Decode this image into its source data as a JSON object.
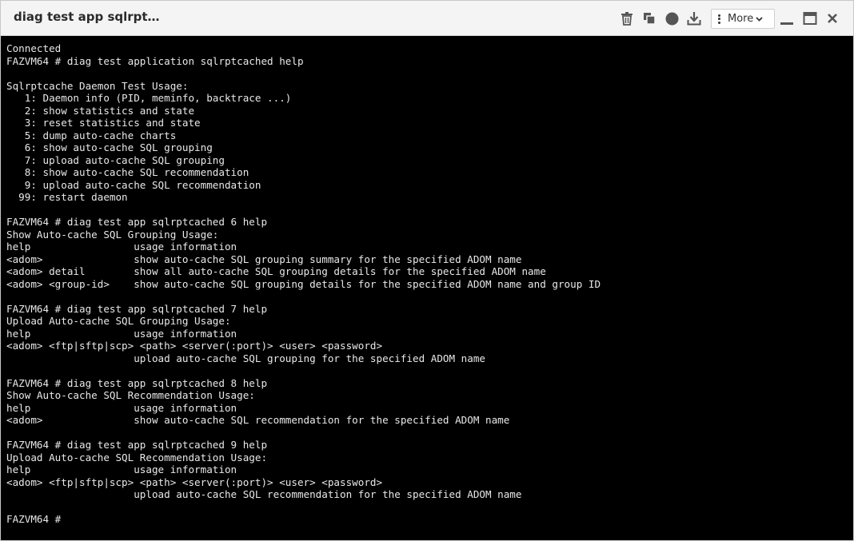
{
  "window": {
    "title": "diag test app sqlrpt…",
    "more_label": "More"
  },
  "toolbar": {
    "icons": [
      "trash-icon",
      "copy-icon",
      "record-icon",
      "download-icon",
      "more-kebab-icon",
      "minimize-icon",
      "maximize-icon",
      "close-icon"
    ]
  },
  "colors": {
    "titlebar_bg": "#f4f4f4",
    "icon_color": "#555555",
    "terminal_bg": "#000000",
    "terminal_fg": "#e8e8e8"
  },
  "terminal": {
    "lines": [
      "Connected",
      "FAZVM64 # diag test application sqlrptcached help",
      "",
      "Sqlrptcache Daemon Test Usage:",
      "   1: Daemon info (PID, meminfo, backtrace ...)",
      "   2: show statistics and state",
      "   3: reset statistics and state",
      "   5: dump auto-cache charts",
      "   6: show auto-cache SQL grouping",
      "   7: upload auto-cache SQL grouping",
      "   8: show auto-cache SQL recommendation",
      "   9: upload auto-cache SQL recommendation",
      "  99: restart daemon",
      "",
      "FAZVM64 # diag test app sqlrptcached 6 help",
      "Show Auto-cache SQL Grouping Usage:",
      "help                 usage information",
      "<adom>               show auto-cache SQL grouping summary for the specified ADOM name",
      "<adom> detail        show all auto-cache SQL grouping details for the specified ADOM name",
      "<adom> <group-id>    show auto-cache SQL grouping details for the specified ADOM name and group ID",
      "",
      "FAZVM64 # diag test app sqlrptcached 7 help",
      "Upload Auto-cache SQL Grouping Usage:",
      "help                 usage information",
      "<adom> <ftp|sftp|scp> <path> <server(:port)> <user> <password>",
      "                     upload auto-cache SQL grouping for the specified ADOM name",
      "",
      "FAZVM64 # diag test app sqlrptcached 8 help",
      "Show Auto-cache SQL Recommendation Usage:",
      "help                 usage information",
      "<adom>               show auto-cache SQL recommendation for the specified ADOM name",
      "",
      "FAZVM64 # diag test app sqlrptcached 9 help",
      "Upload Auto-cache SQL Recommendation Usage:",
      "help                 usage information",
      "<adom> <ftp|sftp|scp> <path> <server(:port)> <user> <password>",
      "                     upload auto-cache SQL recommendation for the specified ADOM name",
      "",
      "FAZVM64 #"
    ]
  }
}
